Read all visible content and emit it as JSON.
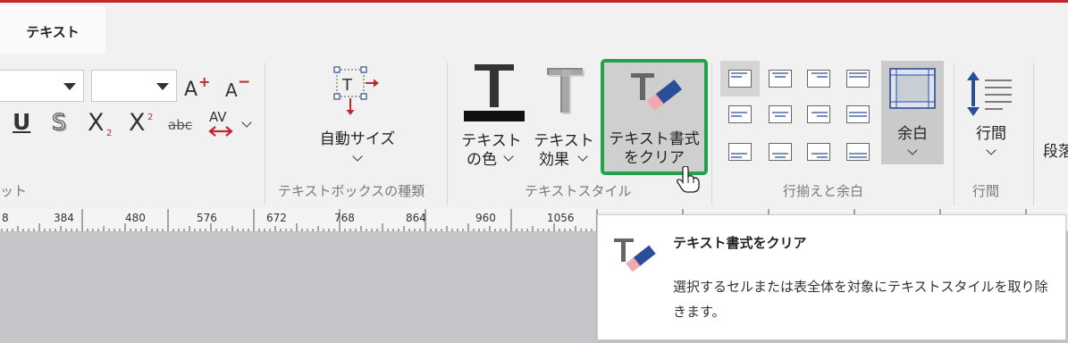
{
  "tabs": {
    "active": "テキスト"
  },
  "font_group": {
    "label": "ット",
    "font_name": "",
    "font_size": "",
    "increase_label": "A",
    "decrease_label": "A",
    "underline_label": "U",
    "shadow_label": "S",
    "subscript_label": "X",
    "subscript_mark": "2",
    "superscript_label": "X",
    "superscript_mark": "2",
    "strike_label": "abc",
    "spacing_label": "AV"
  },
  "textbox_group": {
    "label": "テキストボックスの種類",
    "autosize_label": "自動サイズ"
  },
  "textstyle_group": {
    "label": "テキストスタイル",
    "color_line1": "テキスト",
    "color_line2": "の色",
    "effect_line1": "テキスト",
    "effect_line2": "効果",
    "clear_line1": "テキスト書式",
    "clear_line2": "をクリア"
  },
  "align_group": {
    "label": "行揃えと余白",
    "margin_label": "余白"
  },
  "spacing_group": {
    "label": "行間",
    "line_spacing_label": "行間"
  },
  "paragraph_group": {
    "cut_label": "段落"
  },
  "ruler": {
    "marks": [
      "8",
      "384",
      "480",
      "576",
      "672",
      "768",
      "864",
      "960",
      "1056"
    ]
  },
  "tooltip": {
    "title": "テキスト書式をクリア",
    "body": "選択するセルまたは表全体を対象にテキストスタイルを取り除きます。"
  },
  "colors": {
    "accent_red": "#c0282d",
    "highlight_green": "#22a24a",
    "icon_blue": "#2a4f9a"
  }
}
